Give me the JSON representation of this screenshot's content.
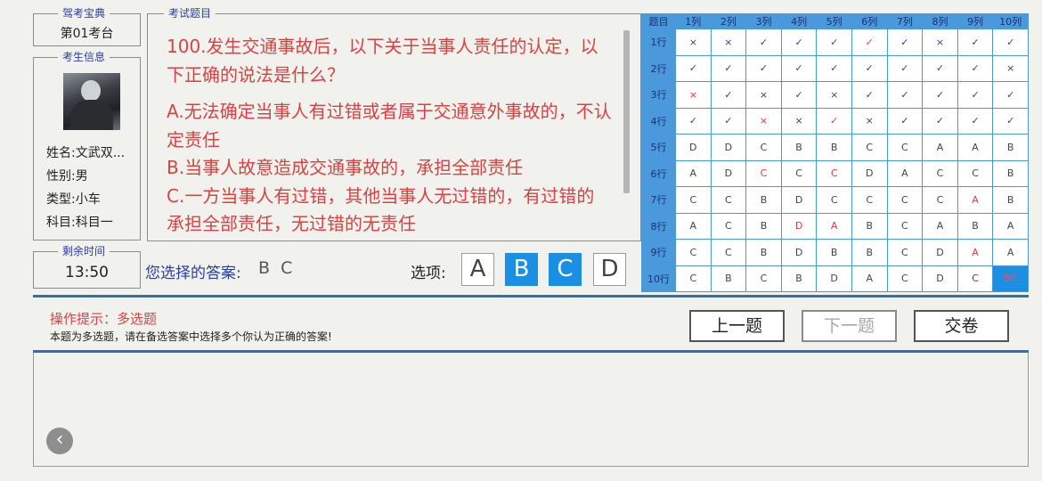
{
  "app": {
    "title": "驾考宝典",
    "station": "第01考台"
  },
  "candidate": {
    "legend": "考生信息",
    "name": "姓名:文武双...",
    "gender": "性别:男",
    "type": "类型:小车",
    "subject": "科目:科目一"
  },
  "timer": {
    "legend": "剩余时间",
    "value": "13:50"
  },
  "question": {
    "legend": "考试题目",
    "text": "100.发生交通事故后，以下关于当事人责任的认定，以下正确的说法是什么？",
    "options": [
      "A.无法确定当事人有过错或者属于交通意外事故的，不认定责任",
      "B.当事人故意造成交通事故的，承担全部责任",
      "C.一方当事人有过错，其他当事人无过错的，有过错的承担全部责任，无过错的无责任"
    ]
  },
  "answer": {
    "label": "您选择的答案:",
    "value": "B C"
  },
  "choices": {
    "label": "选项:",
    "items": [
      {
        "label": "A",
        "selected": false
      },
      {
        "label": "B",
        "selected": true
      },
      {
        "label": "C",
        "selected": true
      },
      {
        "label": "D",
        "selected": false
      }
    ]
  },
  "grid": {
    "corner": "题目",
    "columns": [
      "1列",
      "2列",
      "3列",
      "4列",
      "5列",
      "6列",
      "7列",
      "8列",
      "9列",
      "10列"
    ],
    "rows": [
      {
        "label": "1行",
        "cells": [
          "×",
          "×",
          "✓",
          "✓",
          "✓",
          "✓",
          "✓",
          "×",
          "✓",
          "✓"
        ],
        "red": [
          5
        ]
      },
      {
        "label": "2行",
        "cells": [
          "✓",
          "✓",
          "✓",
          "✓",
          "✓",
          "✓",
          "✓",
          "✓",
          "✓",
          "×"
        ],
        "red": []
      },
      {
        "label": "3行",
        "cells": [
          "×",
          "✓",
          "×",
          "✓",
          "×",
          "✓",
          "✓",
          "✓",
          "✓",
          "✓"
        ],
        "red": [
          0
        ]
      },
      {
        "label": "4行",
        "cells": [
          "✓",
          "✓",
          "×",
          "×",
          "✓",
          "×",
          "✓",
          "✓",
          "✓",
          "✓"
        ],
        "red": [
          2,
          4
        ]
      },
      {
        "label": "5行",
        "cells": [
          "D",
          "D",
          "C",
          "B",
          "B",
          "C",
          "C",
          "A",
          "A",
          "B"
        ],
        "red": []
      },
      {
        "label": "6行",
        "cells": [
          "A",
          "D",
          "C",
          "C",
          "C",
          "D",
          "A",
          "C",
          "C",
          "B"
        ],
        "red": [
          2,
          4
        ]
      },
      {
        "label": "7行",
        "cells": [
          "C",
          "C",
          "B",
          "D",
          "C",
          "C",
          "C",
          "C",
          "A",
          "B"
        ],
        "red": [
          8
        ]
      },
      {
        "label": "8行",
        "cells": [
          "A",
          "C",
          "B",
          "D",
          "A",
          "B",
          "C",
          "A",
          "B",
          "A"
        ],
        "red": [
          3,
          4
        ]
      },
      {
        "label": "9行",
        "cells": [
          "C",
          "C",
          "B",
          "D",
          "B",
          "B",
          "C",
          "D",
          "A",
          "A"
        ],
        "red": [
          8
        ]
      },
      {
        "label": "10行",
        "cells": [
          "C",
          "B",
          "C",
          "B",
          "D",
          "A",
          "C",
          "D",
          "C",
          "BC"
        ],
        "red": [],
        "current": 9
      }
    ]
  },
  "hint": {
    "title": "操作提示：多选题",
    "body": "本题为多选题，请在备选答案中选择多个你认为正确的答案!"
  },
  "nav": {
    "prev": "上一题",
    "next": "下一题",
    "submit": "交卷"
  },
  "icons": {
    "back": "back-arrow-icon"
  },
  "colors": {
    "accent": "#1a8fe3",
    "question": "#d84242",
    "legend": "#2b3f9a",
    "divider": "#2e6fbd"
  }
}
